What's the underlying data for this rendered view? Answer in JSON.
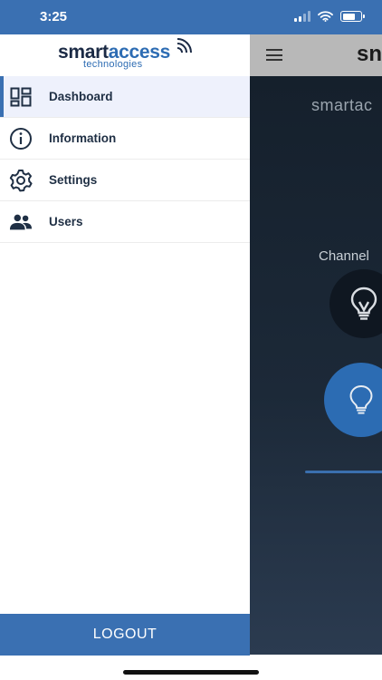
{
  "status_bar": {
    "time": "3:25"
  },
  "drawer": {
    "logo": {
      "main_part1": "smart",
      "main_part2": "access",
      "sub": "technologies"
    },
    "menu_items": [
      {
        "label": "Dashboard",
        "icon": "dashboard-icon",
        "active": true
      },
      {
        "label": "Information",
        "icon": "info-icon",
        "active": false
      },
      {
        "label": "Settings",
        "icon": "gear-icon",
        "active": false
      },
      {
        "label": "Users",
        "icon": "users-icon",
        "active": false
      }
    ],
    "logout_label": "LOGOUT"
  },
  "background_app": {
    "header_brand": "sn",
    "title": "smartac",
    "channel_label": "Channel"
  },
  "colors": {
    "accent": "#3a70b2",
    "active_item_bg": "#eef1fc",
    "menu_text": "#1f2f44",
    "background_dark": "#15202c"
  }
}
